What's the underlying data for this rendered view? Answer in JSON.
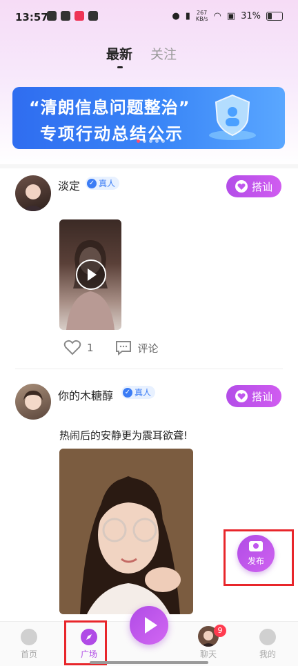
{
  "status": {
    "time": "13:57",
    "network_speed_value": "267",
    "network_speed_unit": "KB/s",
    "battery": "31%"
  },
  "tabs": [
    {
      "label": "最新",
      "active": true
    },
    {
      "label": "关注",
      "active": false
    }
  ],
  "banner": {
    "line1": "“清朗信息问题整治”",
    "line2": "专项行动总结公示"
  },
  "posts": [
    {
      "username": "淡定",
      "verified_label": "真人",
      "chat_button": "搭讪",
      "media_type": "video",
      "likes": "1",
      "comment_label": "评论"
    },
    {
      "username": "你的木糖醇",
      "verified_label": "真人",
      "chat_button": "搭讪",
      "text": "热闹后的安静更为震耳欲聋!",
      "media_type": "image"
    }
  ],
  "publish_button": {
    "label": "发布",
    "icon": "camera-icon"
  },
  "bottom_nav": {
    "items": [
      {
        "label": "首页",
        "icon": "home-icon"
      },
      {
        "label": "广场",
        "icon": "compass-icon",
        "active": true
      },
      {
        "label": "聊天",
        "icon": "avatar",
        "badge": "9"
      },
      {
        "label": "我的",
        "icon": "profile-icon"
      }
    ]
  },
  "colors": {
    "accent": "#b04be6",
    "highlight": "#e8262b",
    "verified": "#3b7cf5"
  }
}
